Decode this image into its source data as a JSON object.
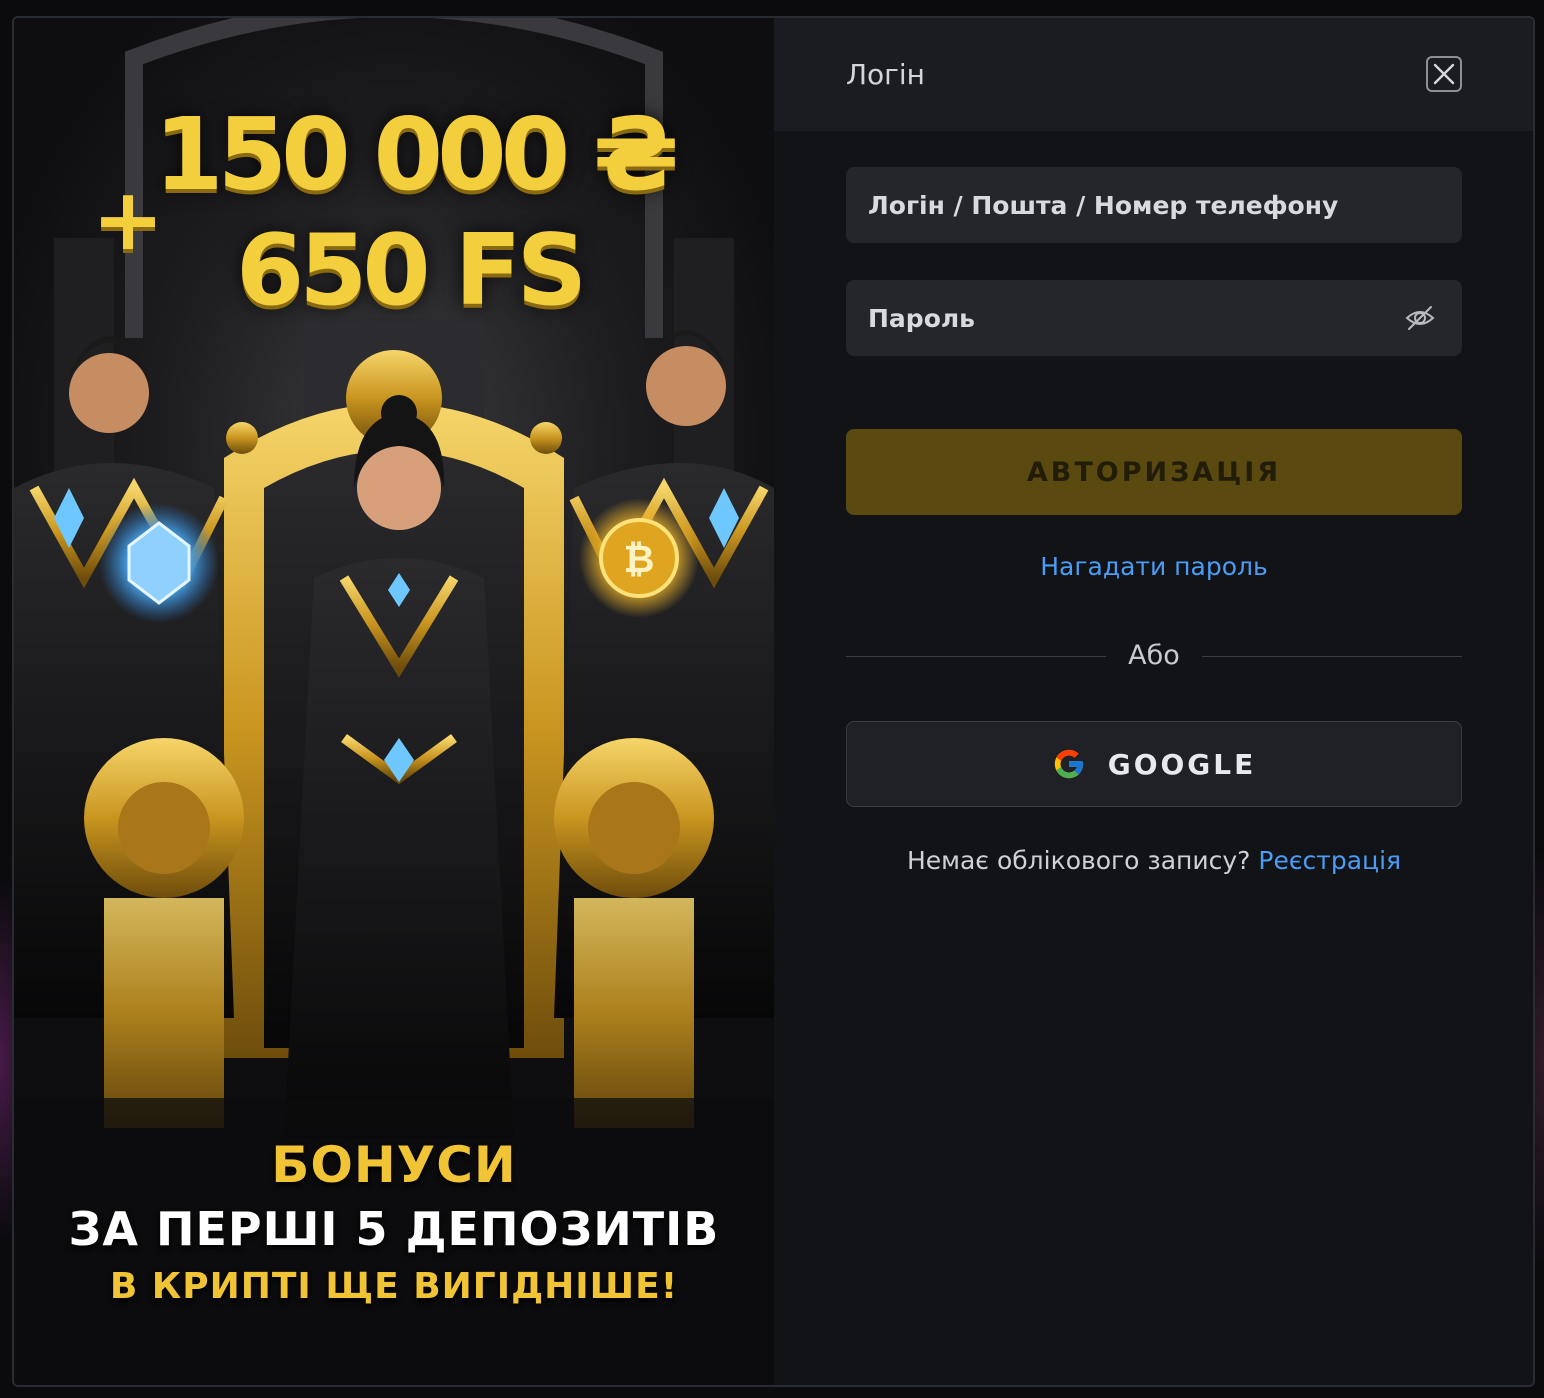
{
  "promo": {
    "amount": "150 000 ₴",
    "plus": "+",
    "freespins": "650 FS",
    "line1": "БОНУСИ",
    "line2": "ЗА ПЕРШІ 5 ДЕПОЗИТІВ",
    "line3": "В КРИПТІ ЩЕ ВИГІДНІШЕ!"
  },
  "form": {
    "title": "Логін",
    "login_placeholder": "Логін / Пошта / Номер телефону",
    "password_placeholder": "Пароль",
    "submit_label": "АВТОРИЗАЦІЯ",
    "forgot_label": "Нагадати пароль",
    "or_label": "Або",
    "google_label": "GOOGLE",
    "no_account_text": "Немає облікового запису?",
    "register_label": "Реєстрація"
  },
  "colors": {
    "accent_gold": "#f3cf3d",
    "submit_bg": "#5a4a10",
    "link_blue": "#4b9cf5",
    "panel_bg": "#121317",
    "field_bg": "#24262c"
  },
  "icons": {
    "close": "close-icon",
    "password_visibility": "eye-off-icon",
    "google": "google-icon"
  }
}
